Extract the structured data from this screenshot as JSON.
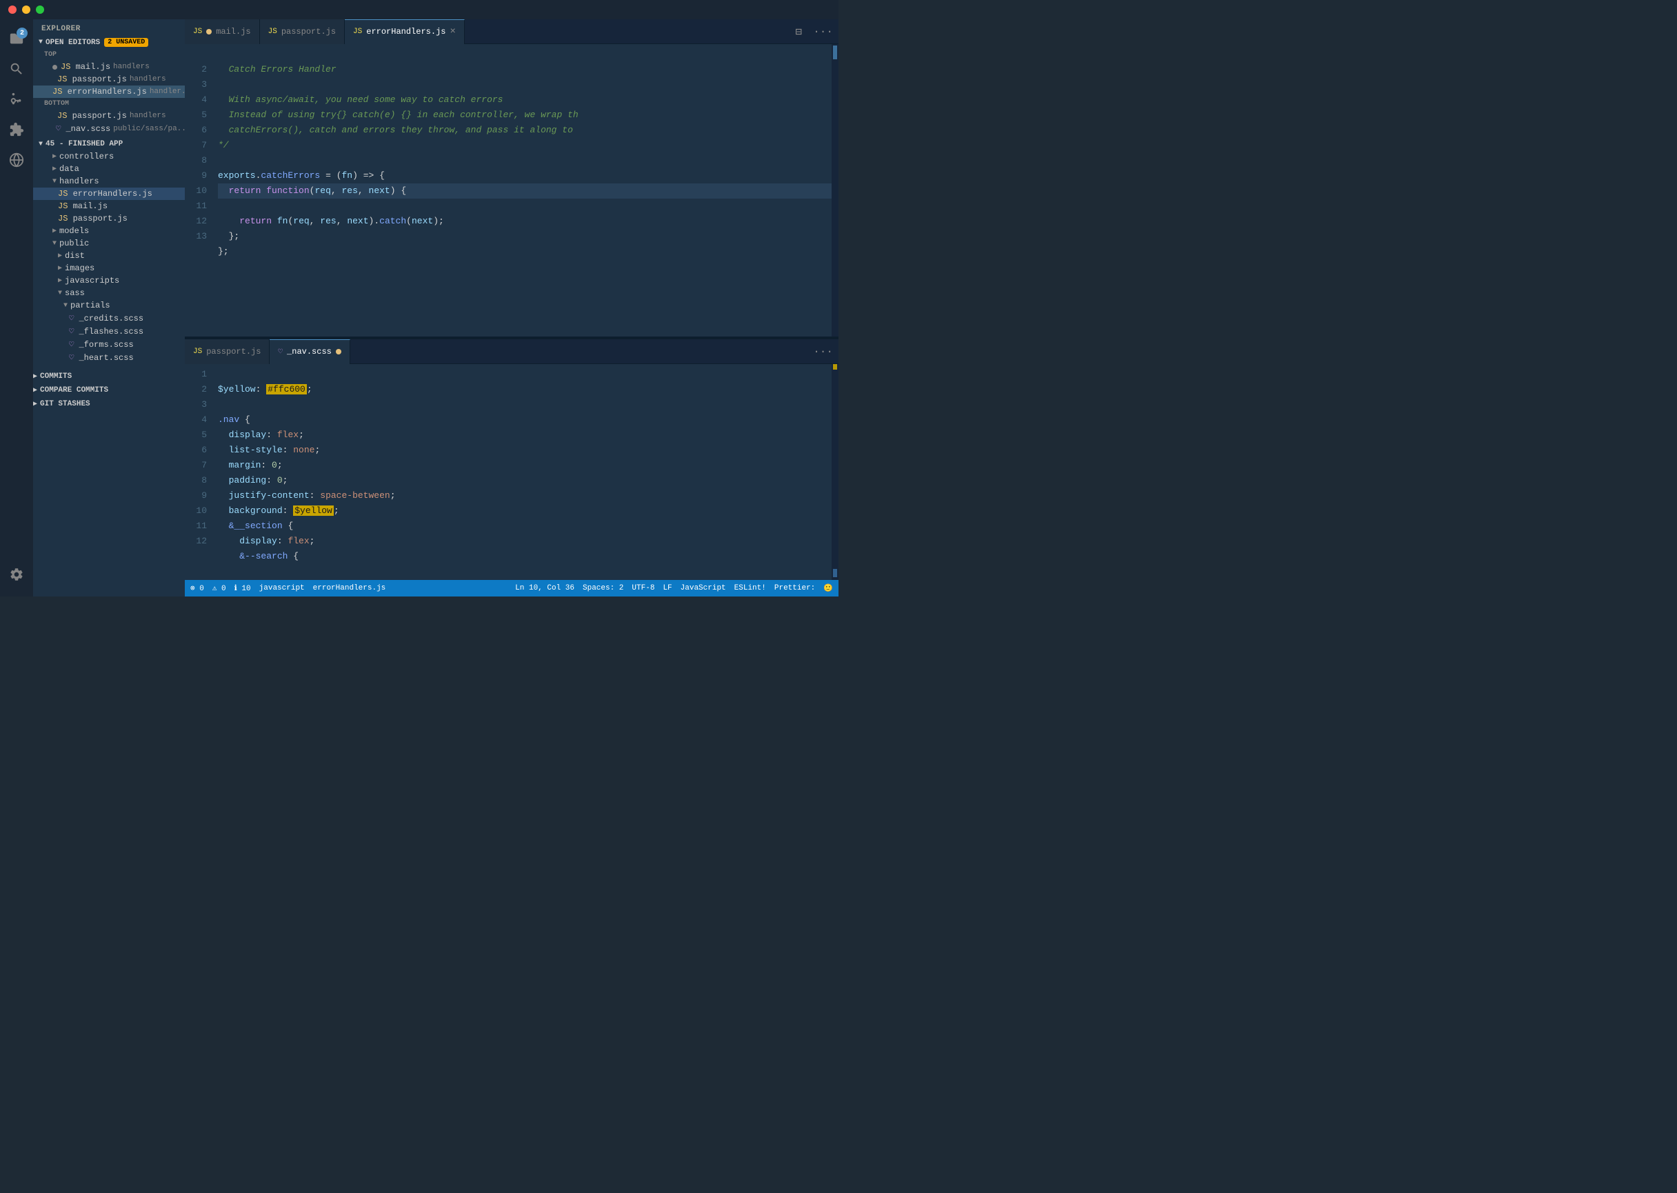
{
  "titlebar": {
    "traffic_lights": [
      "red",
      "yellow",
      "green"
    ]
  },
  "activity_bar": {
    "icons": [
      {
        "name": "files-icon",
        "label": "Explorer",
        "active": false,
        "badge": "2"
      },
      {
        "name": "search-icon",
        "label": "Search",
        "active": false
      },
      {
        "name": "source-control-icon",
        "label": "Source Control",
        "active": false
      },
      {
        "name": "extensions-icon",
        "label": "Extensions",
        "active": false
      },
      {
        "name": "remote-icon",
        "label": "Remote",
        "active": false
      }
    ],
    "bottom_icons": [
      {
        "name": "settings-icon",
        "label": "Settings"
      }
    ]
  },
  "sidebar": {
    "title": "EXPLORER",
    "open_editors": {
      "label": "OPEN EDITORS",
      "badge": "2 UNSAVED",
      "sections": [
        {
          "name": "TOP",
          "items": [
            {
              "name": "mail.js",
              "path": "handlers",
              "type": "js",
              "dot": "grey"
            },
            {
              "name": "passport.js",
              "path": "handlers",
              "type": "js"
            },
            {
              "name": "errorHandlers.js",
              "path": "handler...",
              "type": "js",
              "active": true
            }
          ]
        },
        {
          "name": "BOTTOM",
          "items": [
            {
              "name": "passport.js",
              "path": "handlers",
              "type": "js"
            },
            {
              "name": "_nav.scss",
              "path": "public/sass/pa...",
              "type": "css",
              "dot": "yellow"
            }
          ]
        }
      ]
    },
    "project": {
      "name": "45 - FINISHED APP",
      "items": [
        {
          "name": "controllers",
          "type": "folder",
          "indent": 1
        },
        {
          "name": "data",
          "type": "folder",
          "indent": 1
        },
        {
          "name": "handlers",
          "type": "folder",
          "indent": 1,
          "expanded": true,
          "children": [
            {
              "name": "errorHandlers.js",
              "type": "js",
              "indent": 2,
              "active": true
            },
            {
              "name": "mail.js",
              "type": "js",
              "indent": 2
            },
            {
              "name": "passport.js",
              "type": "js",
              "indent": 2
            }
          ]
        },
        {
          "name": "models",
          "type": "folder",
          "indent": 1
        },
        {
          "name": "public",
          "type": "folder",
          "indent": 1,
          "expanded": true,
          "children": [
            {
              "name": "dist",
              "type": "folder",
              "indent": 2
            },
            {
              "name": "images",
              "type": "folder",
              "indent": 2
            },
            {
              "name": "javascripts",
              "type": "folder",
              "indent": 2
            },
            {
              "name": "sass",
              "type": "folder",
              "indent": 2,
              "expanded": true,
              "children": [
                {
                  "name": "partials",
                  "type": "folder",
                  "indent": 3,
                  "expanded": true,
                  "children": [
                    {
                      "name": "_credits.scss",
                      "type": "css",
                      "indent": 4
                    },
                    {
                      "name": "_flashes.scss",
                      "type": "css",
                      "indent": 4
                    },
                    {
                      "name": "_forms.scss",
                      "type": "css",
                      "indent": 4
                    },
                    {
                      "name": "_heart.scss",
                      "type": "css",
                      "indent": 4
                    }
                  ]
                }
              ]
            }
          ]
        }
      ]
    },
    "git_sections": [
      {
        "name": "COMMITS",
        "expanded": false
      },
      {
        "name": "COMPARE COMMITS",
        "expanded": false
      },
      {
        "name": "GIT STASHES",
        "expanded": false
      }
    ]
  },
  "top_editor": {
    "tabs": [
      {
        "label": "mail.js",
        "type": "js",
        "dot": true,
        "active": false
      },
      {
        "label": "passport.js",
        "type": "js",
        "dot": false,
        "active": false
      },
      {
        "label": "errorHandlers.js",
        "type": "js",
        "dot": false,
        "active": true,
        "closeable": true
      }
    ],
    "lines": [
      {
        "num": "",
        "content": "'",
        "type": "comment_open"
      },
      {
        "num": "2",
        "content": "  Catch Errors Handler",
        "type": "italic_comment"
      },
      {
        "num": "3",
        "content": "",
        "type": "empty"
      },
      {
        "num": "4",
        "content": "  With async/await, you need some way to catch errors",
        "type": "italic_comment"
      },
      {
        "num": "5",
        "content": "  Instead of using try{} catch(e) {} in each controller, we wrap th",
        "type": "italic_comment"
      },
      {
        "num": "6",
        "content": "  catchErrors(), catch and errors they throw, and pass it along to",
        "type": "italic_comment"
      },
      {
        "num": "7",
        "content": "*/",
        "type": "comment_close"
      },
      {
        "num": "8",
        "content": "",
        "type": "empty"
      },
      {
        "num": "9",
        "content": "exports.catchErrors = (fn) => {",
        "type": "code"
      },
      {
        "num": "10",
        "content": "  return function(req, res, next) {",
        "type": "code_highlight"
      },
      {
        "num": "11",
        "content": "    return fn(req, res, next).catch(next);",
        "type": "code"
      },
      {
        "num": "12",
        "content": "  };",
        "type": "code"
      },
      {
        "num": "13",
        "content": "};",
        "type": "code"
      }
    ]
  },
  "bottom_editor": {
    "tabs": [
      {
        "label": "passport.js",
        "type": "js",
        "active": false
      },
      {
        "label": "_nav.scss",
        "type": "css",
        "dot": true,
        "active": true
      }
    ],
    "lines": [
      {
        "num": "1",
        "content": "$yellow: #ffc600;",
        "type": "scss"
      },
      {
        "num": "2",
        "content": "",
        "type": "empty"
      },
      {
        "num": "3",
        "content": ".nav {",
        "type": "scss_selector"
      },
      {
        "num": "4",
        "content": "  display: flex;",
        "type": "scss_prop"
      },
      {
        "num": "5",
        "content": "  list-style: none;",
        "type": "scss_prop"
      },
      {
        "num": "6",
        "content": "  margin: 0;",
        "type": "scss_prop"
      },
      {
        "num": "7",
        "content": "  padding: 0;",
        "type": "scss_prop"
      },
      {
        "num": "8",
        "content": "  justify-content: space-between;",
        "type": "scss_prop"
      },
      {
        "num": "9",
        "content": "  background: $yellow;",
        "type": "scss_prop_var"
      },
      {
        "num": "10",
        "content": "  &__section {",
        "type": "scss_nested"
      },
      {
        "num": "11",
        "content": "    display: flex;",
        "type": "scss_prop"
      },
      {
        "num": "12",
        "content": "    &--search {",
        "type": "scss_nested"
      }
    ]
  },
  "status_bar": {
    "left": [
      {
        "text": "⊗ 0",
        "type": "normal"
      },
      {
        "text": "⚠ 0",
        "type": "normal"
      },
      {
        "text": "ℹ 10",
        "type": "normal"
      },
      {
        "text": "javascript",
        "type": "normal"
      },
      {
        "text": "errorHandlers.js",
        "type": "normal"
      }
    ],
    "right": [
      {
        "text": "Ln 10, Col 36"
      },
      {
        "text": "Spaces: 2"
      },
      {
        "text": "UTF-8"
      },
      {
        "text": "LF"
      },
      {
        "text": "JavaScript"
      },
      {
        "text": "ESLint!"
      },
      {
        "text": "Prettier:"
      },
      {
        "text": "🙂"
      }
    ]
  }
}
